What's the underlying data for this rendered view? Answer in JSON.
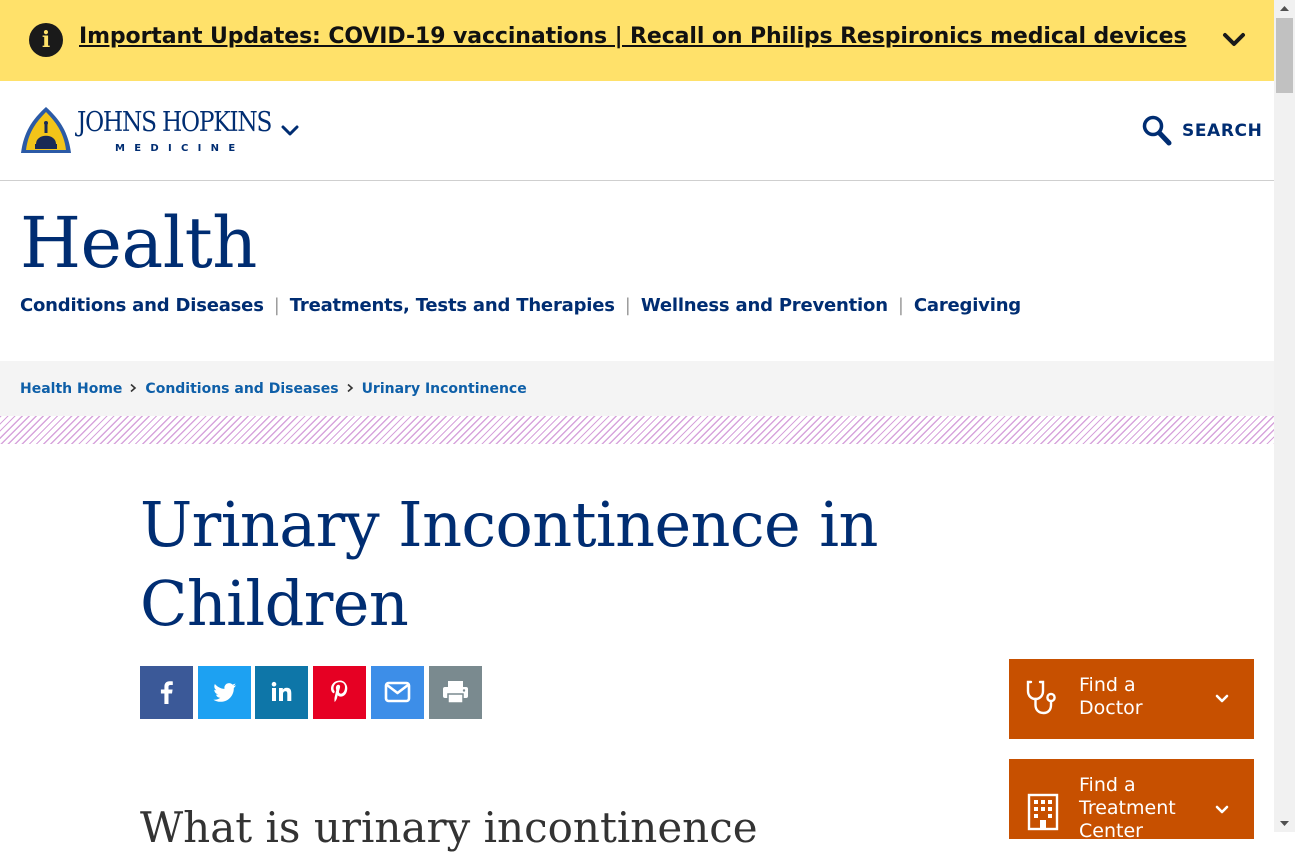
{
  "alert": {
    "link_text": "Important Updates: COVID-19 vaccinations | Recall on Philips Respironics medical devices"
  },
  "header": {
    "logo_title": "JOHNS HOPKINS",
    "logo_subtitle": "MEDICINE",
    "search_label": "SEARCH"
  },
  "section": {
    "title": "Health",
    "nav": [
      {
        "label": "Conditions and Diseases"
      },
      {
        "label": "Treatments, Tests and Therapies"
      },
      {
        "label": "Wellness and Prevention"
      },
      {
        "label": "Caregiving"
      }
    ],
    "separator": "|"
  },
  "breadcrumb": [
    {
      "label": "Health Home"
    },
    {
      "label": "Conditions and Diseases"
    },
    {
      "label": "Urinary Incontinence"
    }
  ],
  "article": {
    "title": "Urinary Incontinence in Children",
    "subhead": "What is urinary incontinence"
  },
  "share": [
    {
      "network": "facebook",
      "icon": "facebook-icon",
      "color": "#3b5998"
    },
    {
      "network": "twitter",
      "icon": "twitter-icon",
      "color": "#1da1f2"
    },
    {
      "network": "linkedin",
      "icon": "linkedin-icon",
      "color": "#0e76a8"
    },
    {
      "network": "pinterest",
      "icon": "pinterest-icon",
      "color": "#e60023"
    },
    {
      "network": "email",
      "icon": "envelope-icon",
      "color": "#3d8ee8"
    },
    {
      "network": "print",
      "icon": "printer-icon",
      "color": "#7a8a8f"
    }
  ],
  "cards": {
    "doctor": {
      "label": "Find a Doctor",
      "icon": "stethoscope-icon"
    },
    "center": {
      "label": "Find a Treatment Center",
      "icon": "building-icon"
    }
  },
  "colors": {
    "alert_bg": "#ffe16a",
    "brand_navy": "#002d72",
    "link_blue": "#0e5fa8",
    "card_orange": "#c75000",
    "hatch_purple": "#d7a4dc"
  }
}
